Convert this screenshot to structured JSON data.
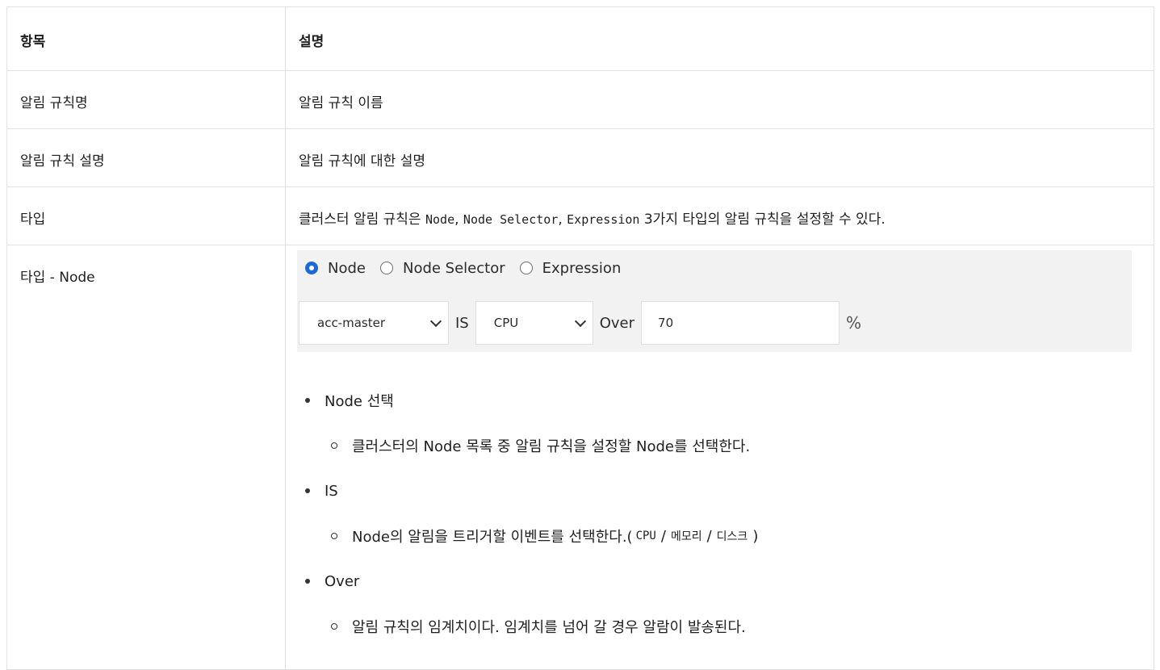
{
  "header": {
    "col1": "항목",
    "col2": "설명"
  },
  "rows": [
    {
      "item": "알림 규칙명",
      "desc": "알림 규칙 이름"
    },
    {
      "item": "알림 규칙 설명",
      "desc": "알림 규칙에 대한 설명"
    }
  ],
  "type_row": {
    "item": "타입",
    "desc_prefix": "클러스터 알림 규칙은",
    "code1": "Node",
    "sep1": ",",
    "code2": "Node Selector",
    "sep2": ",",
    "code3": "Expression",
    "desc_suffix": "3가지 타입의 알림 규칙을 설정할 수 있다."
  },
  "node_row": {
    "item": "타입 - Node",
    "radios": [
      {
        "label": "Node",
        "selected": true
      },
      {
        "label": "Node Selector",
        "selected": false
      },
      {
        "label": "Expression",
        "selected": false
      }
    ],
    "node_select": {
      "value": "acc-master"
    },
    "is_label": "IS",
    "event_select": {
      "value": "CPU"
    },
    "over_label": "Over",
    "threshold": {
      "value": "70"
    },
    "unit": "%",
    "bullets": [
      {
        "title": "Node 선택",
        "detail": "클러스터의 Node 목록 중 알림 규칙을 설정할 Node를 선택한다."
      },
      {
        "title": "IS",
        "detail_prefix": "Node의 알림을 트리거할 이벤트를 선택한다.(",
        "code": "CPU",
        "slash1": "/",
        "mem": "메모리",
        "slash2": "/",
        "disk": "디스크",
        "detail_suffix": ")"
      },
      {
        "title": "Over",
        "detail": "알림 규칙의 임계치이다. 임계치를 넘어 갈 경우 알람이 발송된다."
      }
    ]
  },
  "colors": {
    "radio_selected": "#1c6ad8",
    "form_bg": "#f2f2f2",
    "border": "#e2e2e2"
  }
}
